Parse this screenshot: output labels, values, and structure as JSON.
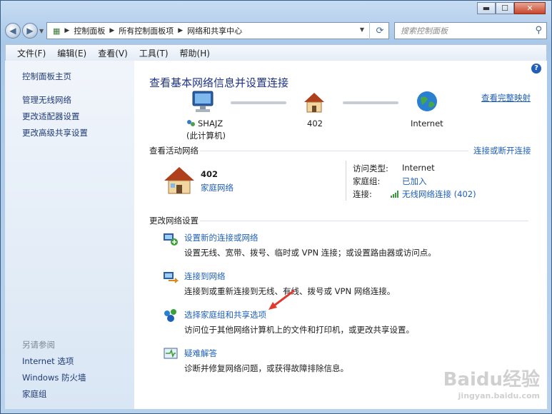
{
  "window": {
    "minimize": "▬",
    "maximize": "☐",
    "close": "✕"
  },
  "address": {
    "crumbs": [
      "控制面板",
      "所有控制面板项",
      "网络和共享中心"
    ],
    "search_placeholder": "搜索控制面板"
  },
  "menu": [
    "文件(F)",
    "编辑(E)",
    "查看(V)",
    "工具(T)",
    "帮助(H)"
  ],
  "sidebar": {
    "home": "控制面板主页",
    "links": [
      "管理无线网络",
      "更改适配器设置",
      "更改高级共享设置"
    ],
    "see_also_title": "另请参阅",
    "see_also": [
      "Internet 选项",
      "Windows 防火墙",
      "家庭组"
    ]
  },
  "main": {
    "title": "查看基本网络信息并设置连接",
    "view_full_map": "查看完整映射",
    "map": {
      "computer_name": "SHAJZ",
      "computer_sub": "(此计算机)",
      "network": "402",
      "internet": "Internet"
    },
    "active_networks_label": "查看活动网络",
    "connect_disconnect": "连接或断开连接",
    "network_name": "402",
    "network_type": "家庭网络",
    "access_type_label": "访问类型:",
    "access_type_value": "Internet",
    "homegroup_label": "家庭组:",
    "homegroup_value": "已加入",
    "connection_label": "连接:",
    "connection_value": "无线网络连接 (402)",
    "change_settings_label": "更改网络设置",
    "tasks": [
      {
        "title": "设置新的连接或网络",
        "desc": "设置无线、宽带、拨号、临时或 VPN 连接；或设置路由器或访问点。"
      },
      {
        "title": "连接到网络",
        "desc": "连接到或重新连接到无线、有线、拨号或 VPN 网络连接。"
      },
      {
        "title": "选择家庭组和共享选项",
        "desc": "访问位于其他网络计算机上的文件和打印机，或更改共享设置。"
      },
      {
        "title": "疑难解答",
        "desc": "诊断并修复网络问题，或获得故障排除信息。"
      }
    ]
  },
  "watermark": {
    "brand": "Baidu经验",
    "url": "jingyan.baidu.com"
  },
  "colors": {
    "link": "#1f5fb8",
    "title": "#1e3287",
    "arrow": "#e03a2e"
  }
}
